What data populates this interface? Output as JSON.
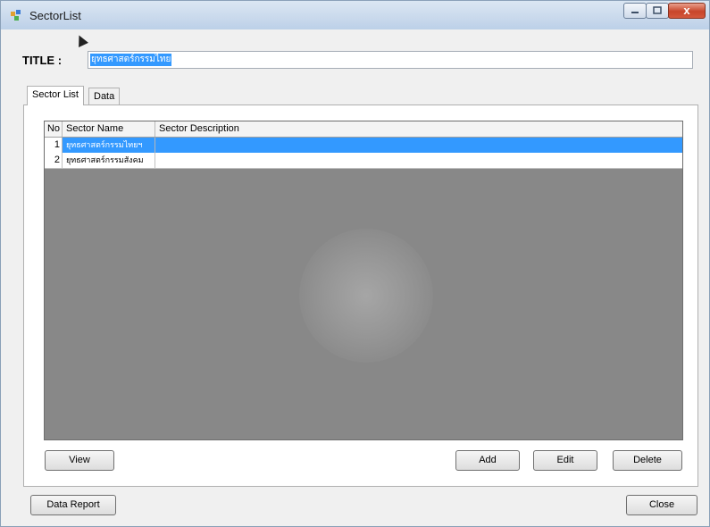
{
  "window": {
    "title": "SectorList",
    "close_glyph": "x"
  },
  "header": {
    "title_label": "TITLE :",
    "title_value": "ยุทธศาสตร์กรรมไทย"
  },
  "tabs": [
    {
      "label": "Sector List"
    },
    {
      "label": "Data"
    }
  ],
  "grid": {
    "columns": [
      "No",
      "Sector Name",
      "Sector Description"
    ],
    "rows": [
      {
        "no": "1",
        "name": "ยุทธศาสตร์กรรมไทยฯ",
        "description": ""
      },
      {
        "no": "2",
        "name": "ยุทธศาสตร์กรรมสังคม",
        "description": ""
      }
    ]
  },
  "buttons": {
    "view": "View",
    "add": "Add",
    "edit": "Edit",
    "delete": "Delete",
    "data_report": "Data Report",
    "close": "Close"
  },
  "icons": [
    "app-icon",
    "minimize-icon",
    "maximize-icon",
    "close-icon",
    "cursor-icon"
  ],
  "colors": {
    "selection": "#3399ff",
    "grid_background": "#888888",
    "close_button": "#c8452a"
  }
}
